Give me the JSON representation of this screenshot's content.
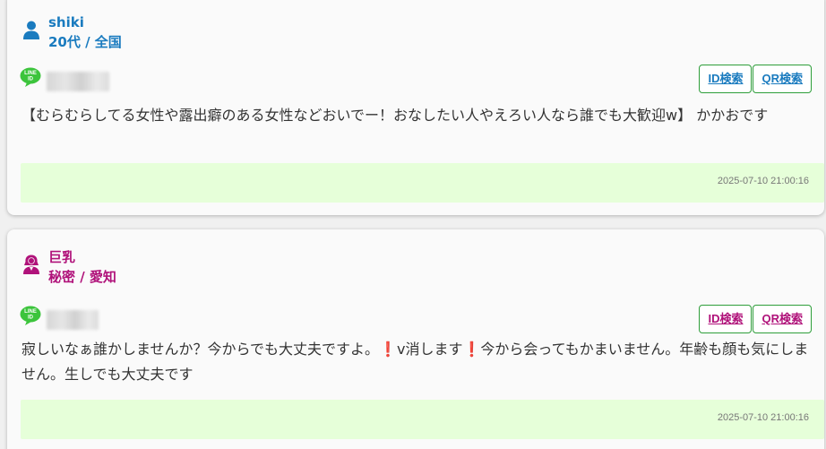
{
  "posts": [
    {
      "user_name": "shiki",
      "user_meta": "20代 / 全国",
      "accent_color": "#1a7bbf",
      "user_icon": "person-icon",
      "line_icon": "line-id-icon",
      "buttons": {
        "id_search": "ID検索",
        "qr_search": "QR検索"
      },
      "message": "【むらむらしてる女性や露出癖のある女性などおいでー！おなしたい人やえろい人なら誰でも大歓迎w】 かかおです",
      "timestamp": "2025-07-10 21:00:16"
    },
    {
      "user_name": "巨乳",
      "user_meta": "秘密 / 愛知",
      "accent_color": "#b0127a",
      "user_icon": "female-person-icon",
      "line_icon": "line-id-icon",
      "buttons": {
        "id_search": "ID検索",
        "qr_search": "QR検索"
      },
      "message_parts": [
        "寂しいなぁ誰かしませんか？今からでも大丈夫ですよ。",
        "❗",
        "v消します",
        "❗",
        "今から会ってもかまいません。年齢も顔も気にしません。生しでも大丈夫です"
      ],
      "timestamp": "2025-07-10 21:00:16"
    }
  ],
  "colors": {
    "button_border": "#2e9e3a",
    "footer_bg": "#e6ffd9",
    "line_green": "#3cc43c",
    "exclamation": "#e0245e"
  }
}
